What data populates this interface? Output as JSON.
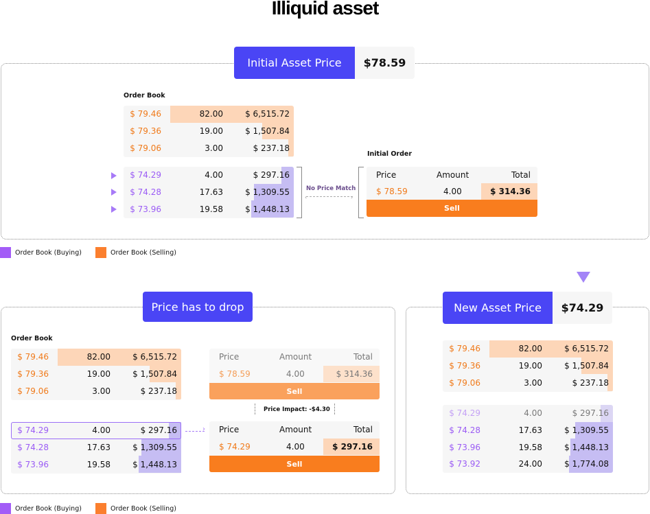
{
  "title": "Illiquid asset",
  "colors": {
    "accent_blue": "#4a45f5",
    "sell_orange": "#f97d1e",
    "sell_bar": "#fdd6b8",
    "buy_purple": "#9b5cf5",
    "buy_bar": "#c6bdf3"
  },
  "initial": {
    "badge_label": "Initial Asset Price",
    "badge_value": "$78.59",
    "order_book_label": "Order Book",
    "asks": [
      {
        "price": "$ 79.46",
        "amount": "82.00",
        "total": "$ 6,515.72",
        "depth": 0.7
      },
      {
        "price": "$ 79.36",
        "amount": "19.00",
        "total": "$ 1,507.84",
        "depth": 0.19
      },
      {
        "price": "$ 79.06",
        "amount": "3.00",
        "total": "$ 237.18",
        "depth": 0.03
      }
    ],
    "bids": [
      {
        "price": "$ 74.29",
        "amount": "4.00",
        "total": "$ 297.16",
        "depth": 0.08
      },
      {
        "price": "$ 74.28",
        "amount": "17.63",
        "total": "$ 1,309.55",
        "depth": 0.24
      },
      {
        "price": "$ 73.96",
        "amount": "19.58",
        "total": "$ 1,448.13",
        "depth": 0.26
      }
    ],
    "no_match_label": "No Price Match",
    "initial_order_label": "Initial Order",
    "order": {
      "headers": [
        "Price",
        "Amount",
        "Total"
      ],
      "price": "$ 78.59",
      "amount": "4.00",
      "total": "$ 314.36",
      "button": "Sell"
    }
  },
  "legend": {
    "buying": "Order Book (Buying)",
    "selling": "Order Book (Selling)"
  },
  "drop": {
    "badge_label": "Price has to drop",
    "order_book_label": "Order Book",
    "asks": [
      {
        "price": "$ 79.46",
        "amount": "82.00",
        "total": "$ 6,515.72",
        "depth": 0.7
      },
      {
        "price": "$ 79.36",
        "amount": "19.00",
        "total": "$ 1,507.84",
        "depth": 0.19
      },
      {
        "price": "$ 79.06",
        "amount": "3.00",
        "total": "$ 237.18",
        "depth": 0.03
      }
    ],
    "bids": [
      {
        "price": "$ 74.29",
        "amount": "4.00",
        "total": "$ 297.16",
        "depth": 0.08
      },
      {
        "price": "$ 74.28",
        "amount": "17.63",
        "total": "$ 1,309.55",
        "depth": 0.24
      },
      {
        "price": "$ 73.96",
        "amount": "19.58",
        "total": "$ 1,448.13",
        "depth": 0.26
      }
    ],
    "order_before": {
      "headers": [
        "Price",
        "Amount",
        "Total"
      ],
      "price": "$ 78.59",
      "amount": "4.00",
      "total": "$ 314.36",
      "button": "Sell"
    },
    "impact_label": "Price Impact: -$4.30",
    "order_after": {
      "headers": [
        "Price",
        "Amount",
        "Total"
      ],
      "price": "$ 74.29",
      "amount": "4.00",
      "total": "$ 297.16",
      "button": "Sell"
    }
  },
  "new_price": {
    "badge_label": "New Asset Price",
    "badge_value": "$74.29",
    "asks": [
      {
        "price": "$ 79.46",
        "amount": "82.00",
        "total": "$ 6,515.72",
        "depth": 0.7
      },
      {
        "price": "$ 79.36",
        "amount": "19.00",
        "total": "$ 1,507.84",
        "depth": 0.19
      },
      {
        "price": "$ 79.06",
        "amount": "3.00",
        "total": "$ 237.18",
        "depth": 0.03
      }
    ],
    "bids": [
      {
        "price": "$ 74.29",
        "amount": "4.00",
        "total": "$ 297.16",
        "depth": 0.08,
        "faded": true
      },
      {
        "price": "$ 74.28",
        "amount": "17.63",
        "total": "$ 1,309.55",
        "depth": 0.24
      },
      {
        "price": "$ 73.96",
        "amount": "19.58",
        "total": "$ 1,448.13",
        "depth": 0.26
      },
      {
        "price": "$ 73.92",
        "amount": "24.00",
        "total": "$ 1,774.08",
        "depth": 0.27
      }
    ]
  }
}
